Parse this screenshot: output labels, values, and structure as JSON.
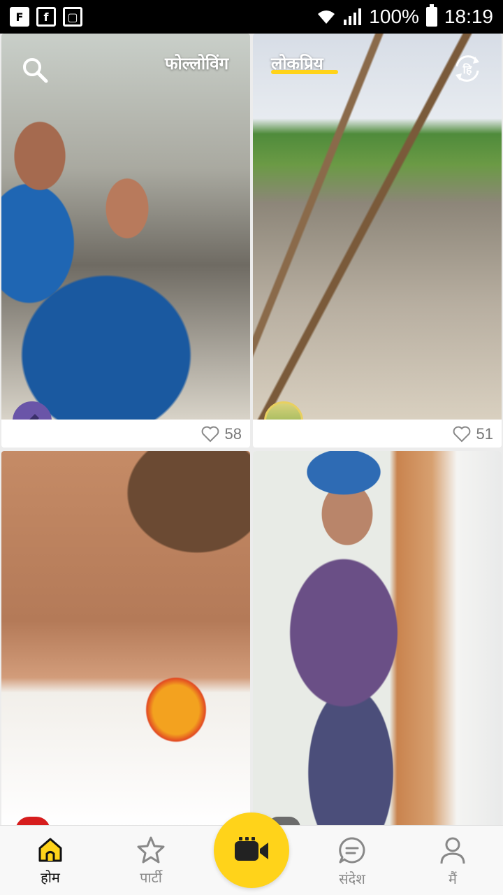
{
  "status_bar": {
    "icons": [
      "flipboard-icon",
      "facebook-icon",
      "screenshot-icon"
    ],
    "battery": "100%",
    "time": "18:19"
  },
  "top_bar": {
    "following_label": "फोल्लोविंग",
    "popular_label": "लोकप्रिय",
    "lang_label": "हि"
  },
  "feed": [
    {
      "likes": "58",
      "avatar": "pencil-avatar"
    },
    {
      "likes": "51",
      "avatar": "user-avatar"
    }
  ],
  "bottom_nav": {
    "home_label": "होम",
    "party_label": "पार्टी",
    "messages_label": "संदेश",
    "me_label": "मैं"
  },
  "colors": {
    "accent": "#ffd31a",
    "text_active": "#111111",
    "text_inactive": "#888888"
  }
}
